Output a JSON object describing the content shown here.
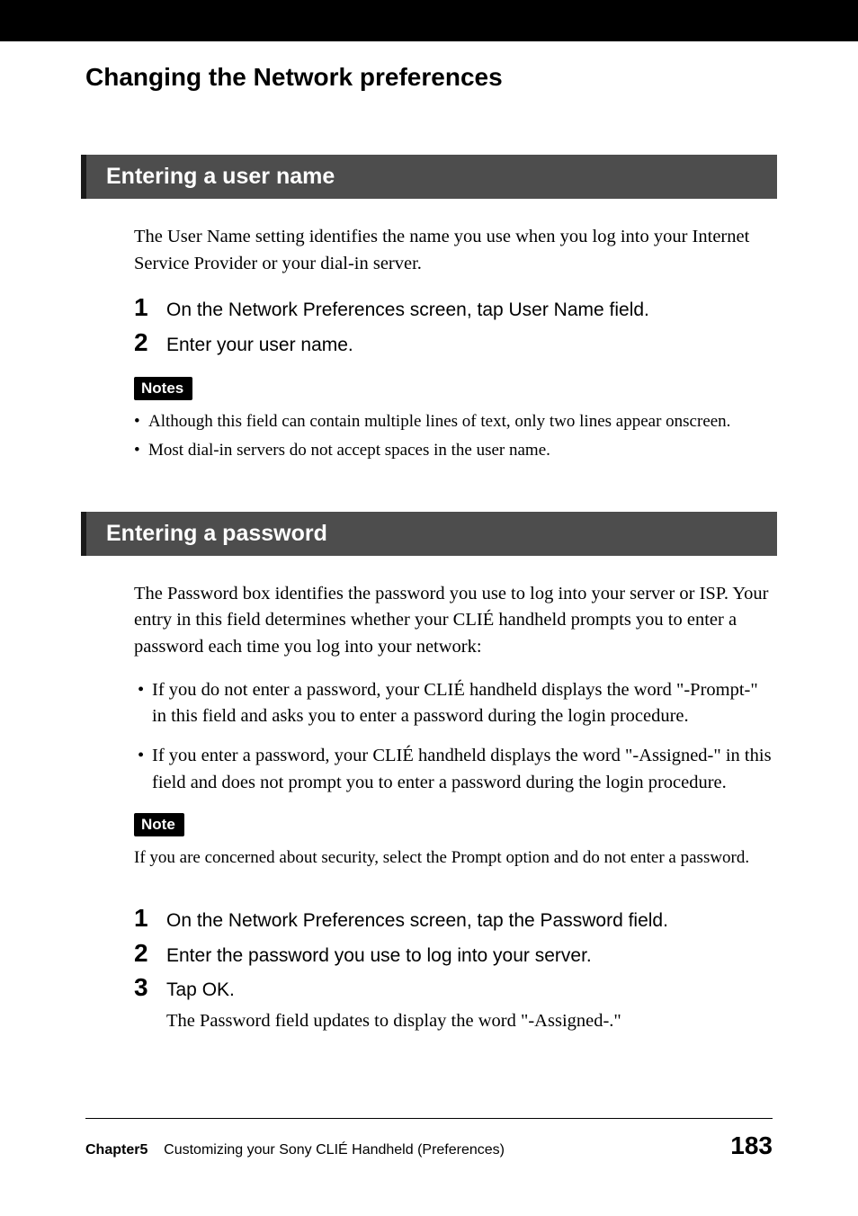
{
  "pageTitle": "Changing the Network preferences",
  "section1": {
    "heading": "Entering a user name",
    "intro": "The User Name setting identifies the name you use when you log into your Internet Service Provider or your dial-in server.",
    "steps": [
      {
        "num": "1",
        "text": "On the Network Preferences screen, tap User Name field."
      },
      {
        "num": "2",
        "text": "Enter your user name."
      }
    ],
    "notesLabel": "Notes",
    "notes": [
      "Although this field can contain multiple lines of text, only two lines appear onscreen.",
      "Most dial-in servers do not accept spaces in the user name."
    ]
  },
  "section2": {
    "heading": "Entering a password",
    "intro": "The Password box identifies the password you use to log into your server or ISP. Your entry in this field determines whether your CLIÉ handheld prompts you to enter a password each time you log into your network:",
    "bullets": [
      "If you do not enter a password, your CLIÉ handheld displays the word \"-Prompt-\" in this field and asks you to enter a password during the login procedure.",
      "If you enter a password, your CLIÉ handheld displays the word \"-Assigned-\" in this field and does not prompt you to enter a password during the login procedure."
    ],
    "noteLabel": "Note",
    "noteText": "If you are concerned about security, select the Prompt option and do not enter a password.",
    "steps": [
      {
        "num": "1",
        "text": "On the Network Preferences screen, tap the Password field."
      },
      {
        "num": "2",
        "text": "Enter the password you use to log into your server."
      },
      {
        "num": "3",
        "text": "Tap OK.",
        "subtext": "The Password field updates to display the word \"-Assigned-.\""
      }
    ]
  },
  "footer": {
    "chapter": "Chapter5",
    "title": "Customizing your Sony CLIÉ Handheld (Preferences)",
    "page": "183"
  }
}
